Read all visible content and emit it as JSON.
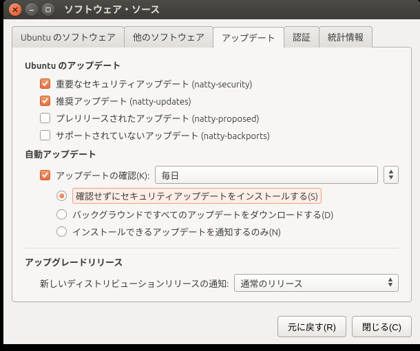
{
  "window": {
    "title": "ソフトウェア・ソース"
  },
  "tabs": [
    "Ubuntu のソフトウェア",
    "他のソフトウェア",
    "アップデート",
    "認証",
    "統計情報"
  ],
  "sections": {
    "updates_title": "Ubuntu のアップデート",
    "update_options": [
      {
        "label": "重要なセキュリティアップデート (natty-security)",
        "checked": true
      },
      {
        "label": "推奨アップデート (natty-updates)",
        "checked": true
      },
      {
        "label": "プレリリースされたアップデート (natty-proposed)",
        "checked": false
      },
      {
        "label": "サポートされていないアップデート (natty-backports)",
        "checked": false
      }
    ],
    "auto_title": "自動アップデート",
    "check_label": "アップデートの確認(K):",
    "check_value": "毎日",
    "auto_radios": [
      {
        "label": "確認せずにセキュリティアップデートをインストールする(S)",
        "checked": true
      },
      {
        "label": "バックグラウンドですべてのアップデートをダウンロードする(D)",
        "checked": false
      },
      {
        "label": "インストールできるアップデートを通知するのみ(N)",
        "checked": false
      }
    ],
    "release_title": "アップグレードリリース",
    "release_label": "新しいディストリビューションリリースの通知:",
    "release_value": "通常のリリース"
  },
  "buttons": {
    "revert": "元に戻す(R)",
    "close": "閉じる(C)"
  }
}
